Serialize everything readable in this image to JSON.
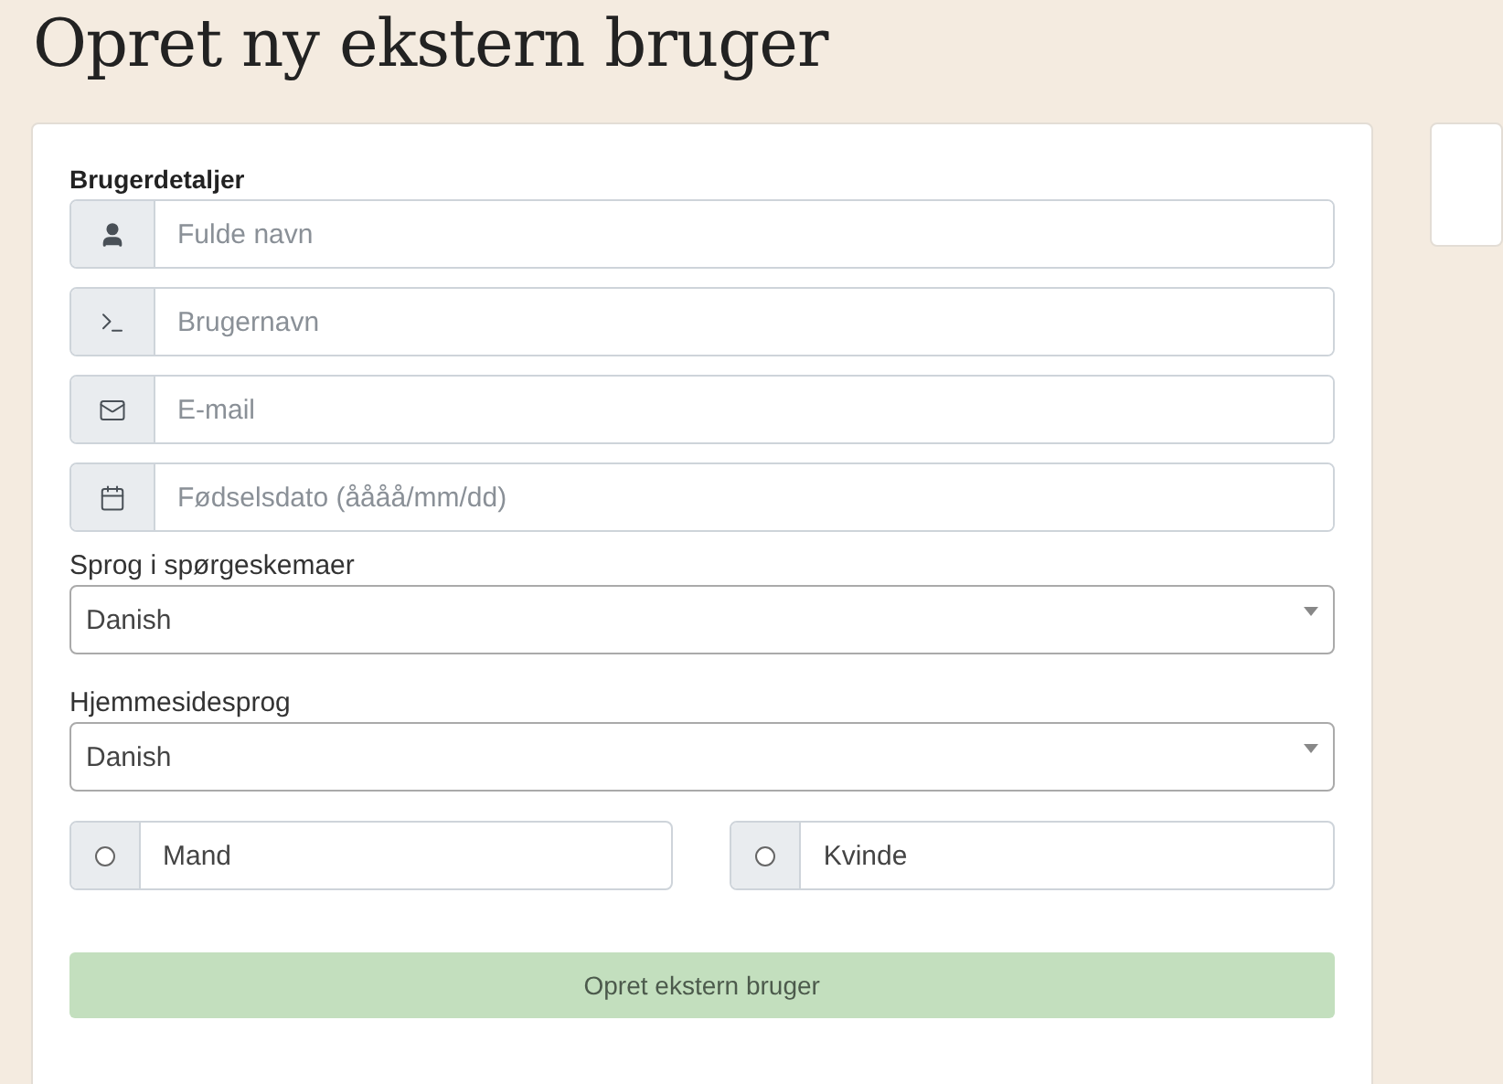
{
  "title": "Opret ny ekstern bruger",
  "form": {
    "section_title": "Brugerdetaljer",
    "fields": [
      {
        "kind": "user",
        "placeholder": "Fulde navn"
      },
      {
        "kind": "terminal",
        "placeholder": "Brugernavn"
      },
      {
        "kind": "mail",
        "placeholder": "E-mail"
      },
      {
        "kind": "calendar",
        "placeholder": "Fødselsdato (åååå/mm/dd)"
      }
    ],
    "selects": [
      {
        "label": "Sprog i spørgeskemaer",
        "value": "Danish"
      },
      {
        "label": "Hjemmesidesprog",
        "value": "Danish"
      }
    ],
    "gender": [
      {
        "label": "Mand",
        "selected": false
      },
      {
        "label": "Kvinde",
        "selected": false
      }
    ],
    "submit": "Opret ekstern bruger"
  }
}
